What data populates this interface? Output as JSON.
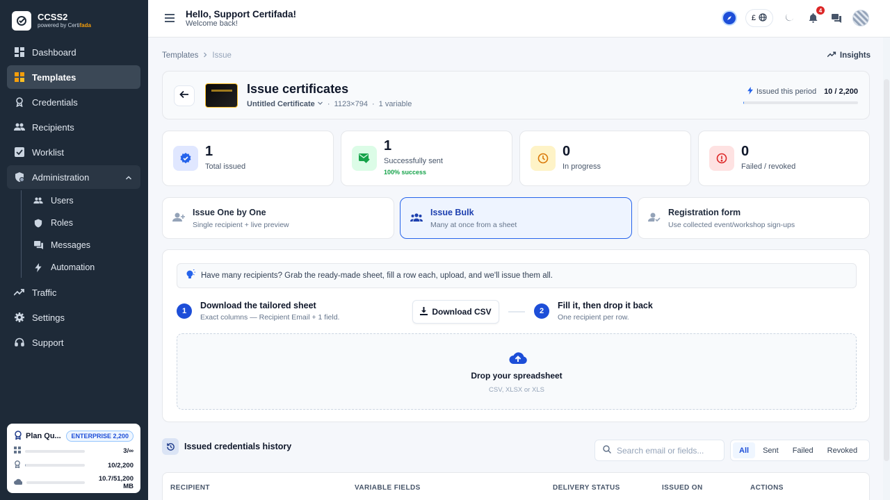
{
  "brand": {
    "name": "CCSS2",
    "sub_prefix": "powered by Certi",
    "sub_accent": "fada"
  },
  "nav": {
    "dashboard": "Dashboard",
    "templates": "Templates",
    "credentials": "Credentials",
    "recipients": "Recipients",
    "worklist": "Worklist",
    "administration": "Administration",
    "users": "Users",
    "roles": "Roles",
    "messages": "Messages",
    "automation": "Automation",
    "traffic": "Traffic",
    "settings": "Settings",
    "support": "Support"
  },
  "plan": {
    "title": "Plan Qu...",
    "badge": "ENTERPRISE 2,200",
    "rows": [
      {
        "value": "3/∞",
        "fraction": 0.0
      },
      {
        "value": "10/2,200",
        "fraction": 0.005
      },
      {
        "value": "10.7/51,200 MB",
        "fraction": 0.0002
      }
    ]
  },
  "header": {
    "greeting": "Hello, Support Certifada!",
    "subtitle": "Welcome back!",
    "lang_code": "£",
    "notification_count": "4"
  },
  "breadcrumb": {
    "parent": "Templates",
    "current": "Issue"
  },
  "insights_label": "Insights",
  "issue": {
    "title": "Issue certificates",
    "template_name": "Untitled Certificate",
    "dimensions": "1123×794",
    "variables": "1 variable",
    "period_label": "Issued this period",
    "period_value": "10 / 2,200",
    "period_fraction": 0.005
  },
  "stats": [
    {
      "value": "1",
      "label": "Total issued",
      "color": "#2563eb"
    },
    {
      "value": "1",
      "label": "Successfully sent",
      "sub": "100% success",
      "color": "#16a34a"
    },
    {
      "value": "0",
      "label": "In progress",
      "color": "#d97706"
    },
    {
      "value": "0",
      "label": "Failed / revoked",
      "color": "#dc2626"
    }
  ],
  "modes": [
    {
      "title": "Issue One by One",
      "sub": "Single recipient + live preview"
    },
    {
      "title": "Issue Bulk",
      "sub": "Many at once from a sheet"
    },
    {
      "title": "Registration form",
      "sub": "Use collected event/workshop sign-ups"
    }
  ],
  "bulk": {
    "hint": "Have many recipients? Grab the ready-made sheet, fill a row each, upload, and we'll issue them all.",
    "step1_num": "1",
    "step1_title": "Download the tailored sheet",
    "step1_sub": "Exact columns — Recipient Email + 1 field.",
    "download_label": "Download CSV",
    "step2_num": "2",
    "step2_title": "Fill it, then drop it back",
    "step2_sub": "One recipient per row.",
    "drop_title": "Drop your spreadsheet",
    "drop_sub": "CSV, XLSX or XLS"
  },
  "history": {
    "title": "Issued credentials history",
    "search_placeholder": "Search email or fields...",
    "filters": [
      "All",
      "Sent",
      "Failed",
      "Revoked"
    ],
    "columns": [
      "RECIPIENT",
      "VARIABLE FIELDS",
      "DELIVERY STATUS",
      "ISSUED ON",
      "ACTIONS"
    ]
  }
}
